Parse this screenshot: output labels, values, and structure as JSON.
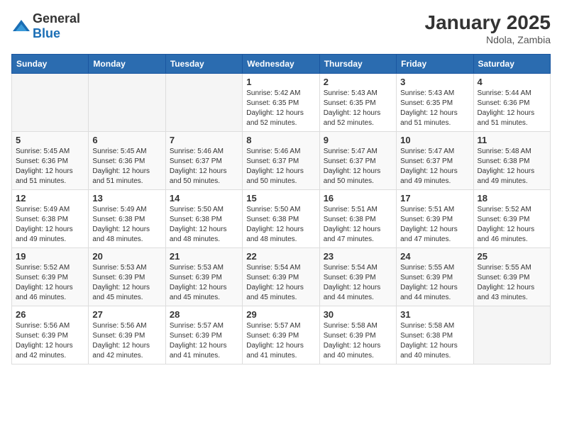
{
  "header": {
    "logo_general": "General",
    "logo_blue": "Blue",
    "title": "January 2025",
    "subtitle": "Ndola, Zambia"
  },
  "days_of_week": [
    "Sunday",
    "Monday",
    "Tuesday",
    "Wednesday",
    "Thursday",
    "Friday",
    "Saturday"
  ],
  "weeks": [
    [
      {
        "day": "",
        "info": ""
      },
      {
        "day": "",
        "info": ""
      },
      {
        "day": "",
        "info": ""
      },
      {
        "day": "1",
        "info": "Sunrise: 5:42 AM\nSunset: 6:35 PM\nDaylight: 12 hours\nand 52 minutes."
      },
      {
        "day": "2",
        "info": "Sunrise: 5:43 AM\nSunset: 6:35 PM\nDaylight: 12 hours\nand 52 minutes."
      },
      {
        "day": "3",
        "info": "Sunrise: 5:43 AM\nSunset: 6:35 PM\nDaylight: 12 hours\nand 51 minutes."
      },
      {
        "day": "4",
        "info": "Sunrise: 5:44 AM\nSunset: 6:36 PM\nDaylight: 12 hours\nand 51 minutes."
      }
    ],
    [
      {
        "day": "5",
        "info": "Sunrise: 5:45 AM\nSunset: 6:36 PM\nDaylight: 12 hours\nand 51 minutes."
      },
      {
        "day": "6",
        "info": "Sunrise: 5:45 AM\nSunset: 6:36 PM\nDaylight: 12 hours\nand 51 minutes."
      },
      {
        "day": "7",
        "info": "Sunrise: 5:46 AM\nSunset: 6:37 PM\nDaylight: 12 hours\nand 50 minutes."
      },
      {
        "day": "8",
        "info": "Sunrise: 5:46 AM\nSunset: 6:37 PM\nDaylight: 12 hours\nand 50 minutes."
      },
      {
        "day": "9",
        "info": "Sunrise: 5:47 AM\nSunset: 6:37 PM\nDaylight: 12 hours\nand 50 minutes."
      },
      {
        "day": "10",
        "info": "Sunrise: 5:47 AM\nSunset: 6:37 PM\nDaylight: 12 hours\nand 49 minutes."
      },
      {
        "day": "11",
        "info": "Sunrise: 5:48 AM\nSunset: 6:38 PM\nDaylight: 12 hours\nand 49 minutes."
      }
    ],
    [
      {
        "day": "12",
        "info": "Sunrise: 5:49 AM\nSunset: 6:38 PM\nDaylight: 12 hours\nand 49 minutes."
      },
      {
        "day": "13",
        "info": "Sunrise: 5:49 AM\nSunset: 6:38 PM\nDaylight: 12 hours\nand 48 minutes."
      },
      {
        "day": "14",
        "info": "Sunrise: 5:50 AM\nSunset: 6:38 PM\nDaylight: 12 hours\nand 48 minutes."
      },
      {
        "day": "15",
        "info": "Sunrise: 5:50 AM\nSunset: 6:38 PM\nDaylight: 12 hours\nand 48 minutes."
      },
      {
        "day": "16",
        "info": "Sunrise: 5:51 AM\nSunset: 6:38 PM\nDaylight: 12 hours\nand 47 minutes."
      },
      {
        "day": "17",
        "info": "Sunrise: 5:51 AM\nSunset: 6:39 PM\nDaylight: 12 hours\nand 47 minutes."
      },
      {
        "day": "18",
        "info": "Sunrise: 5:52 AM\nSunset: 6:39 PM\nDaylight: 12 hours\nand 46 minutes."
      }
    ],
    [
      {
        "day": "19",
        "info": "Sunrise: 5:52 AM\nSunset: 6:39 PM\nDaylight: 12 hours\nand 46 minutes."
      },
      {
        "day": "20",
        "info": "Sunrise: 5:53 AM\nSunset: 6:39 PM\nDaylight: 12 hours\nand 45 minutes."
      },
      {
        "day": "21",
        "info": "Sunrise: 5:53 AM\nSunset: 6:39 PM\nDaylight: 12 hours\nand 45 minutes."
      },
      {
        "day": "22",
        "info": "Sunrise: 5:54 AM\nSunset: 6:39 PM\nDaylight: 12 hours\nand 45 minutes."
      },
      {
        "day": "23",
        "info": "Sunrise: 5:54 AM\nSunset: 6:39 PM\nDaylight: 12 hours\nand 44 minutes."
      },
      {
        "day": "24",
        "info": "Sunrise: 5:55 AM\nSunset: 6:39 PM\nDaylight: 12 hours\nand 44 minutes."
      },
      {
        "day": "25",
        "info": "Sunrise: 5:55 AM\nSunset: 6:39 PM\nDaylight: 12 hours\nand 43 minutes."
      }
    ],
    [
      {
        "day": "26",
        "info": "Sunrise: 5:56 AM\nSunset: 6:39 PM\nDaylight: 12 hours\nand 42 minutes."
      },
      {
        "day": "27",
        "info": "Sunrise: 5:56 AM\nSunset: 6:39 PM\nDaylight: 12 hours\nand 42 minutes."
      },
      {
        "day": "28",
        "info": "Sunrise: 5:57 AM\nSunset: 6:39 PM\nDaylight: 12 hours\nand 41 minutes."
      },
      {
        "day": "29",
        "info": "Sunrise: 5:57 AM\nSunset: 6:39 PM\nDaylight: 12 hours\nand 41 minutes."
      },
      {
        "day": "30",
        "info": "Sunrise: 5:58 AM\nSunset: 6:39 PM\nDaylight: 12 hours\nand 40 minutes."
      },
      {
        "day": "31",
        "info": "Sunrise: 5:58 AM\nSunset: 6:38 PM\nDaylight: 12 hours\nand 40 minutes."
      },
      {
        "day": "",
        "info": ""
      }
    ]
  ]
}
